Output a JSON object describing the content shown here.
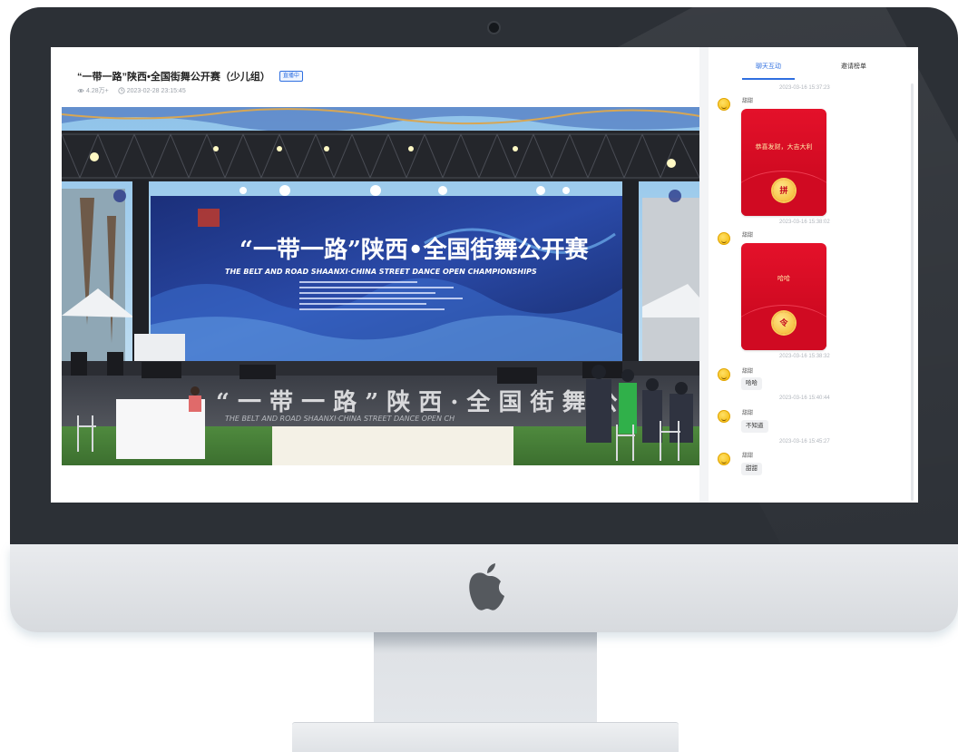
{
  "page": {
    "title": "“一带一路”陕西•全国街舞公开赛（少儿组）",
    "live_badge": "直播中",
    "views": "4.28万+",
    "datetime": "2023-02-28 23:15:45"
  },
  "video": {
    "banner_title_cn": "“一带一路”陕西•全国街舞公开赛",
    "banner_subtitle_en": "THE BELT AND ROAD SHAANXI·CHINA STREET DANCE OPEN CHAMPIONSHIPS",
    "stage_floor_text_cn": "“ 一 带 一 路 ” 陕 西 · 全 国 街 舞 公",
    "stage_floor_text_en": "THE BELT AND ROAD SHAANXI·CHINA STREET DANCE OPEN CH"
  },
  "chat": {
    "tabs": [
      {
        "label": "聊天互动",
        "active": true
      },
      {
        "label": "邀请榜单",
        "active": false
      }
    ],
    "messages": [
      {
        "time": "2023-03-16 15:37:23",
        "user": "甜甜",
        "type": "red_packet",
        "text": "恭喜发财，大吉大利",
        "coin": "拼"
      },
      {
        "time": "2023-03-16 15:38:02",
        "user": "甜甜",
        "type": "red_packet",
        "text": "哈哈",
        "coin": "令"
      },
      {
        "time": "2023-03-16 15:38:32",
        "user": "甜甜",
        "type": "text",
        "text": "哈哈"
      },
      {
        "time": "2023-03-16 15:40:44",
        "user": "甜甜",
        "type": "text",
        "text": "不知道"
      },
      {
        "time": "2023-03-16 15:45:27",
        "user": "甜甜",
        "type": "text",
        "text": "甜甜"
      }
    ]
  },
  "colors": {
    "accent": "#2f6fe0",
    "red_packet": "#d80f25",
    "bezel": "#2c3036"
  }
}
